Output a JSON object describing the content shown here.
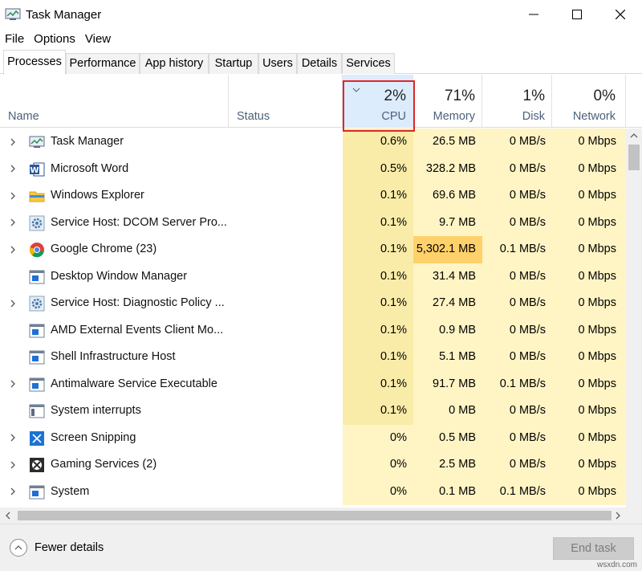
{
  "window": {
    "title": "Task Manager"
  },
  "menu": [
    "File",
    "Options",
    "View"
  ],
  "tabs": [
    "Processes",
    "Performance",
    "App history",
    "Startup",
    "Users",
    "Details",
    "Services"
  ],
  "header": {
    "name": "Name",
    "status": "Status",
    "cpu": {
      "pct": "2%",
      "label": "CPU"
    },
    "memory": {
      "pct": "71%",
      "label": "Memory"
    },
    "disk": {
      "pct": "1%",
      "label": "Disk"
    },
    "network": {
      "pct": "0%",
      "label": "Network"
    }
  },
  "rows": [
    {
      "name": "Task Manager",
      "icon": "task-manager-icon",
      "expand": true,
      "cpu": "0.6%",
      "memory": "26.5 MB",
      "disk": "0 MB/s",
      "network": "0 Mbps"
    },
    {
      "name": "Microsoft Word",
      "icon": "word-icon",
      "expand": true,
      "cpu": "0.5%",
      "memory": "328.2 MB",
      "disk": "0 MB/s",
      "network": "0 Mbps"
    },
    {
      "name": "Windows Explorer",
      "icon": "folder-icon",
      "expand": true,
      "cpu": "0.1%",
      "memory": "69.6 MB",
      "disk": "0 MB/s",
      "network": "0 Mbps"
    },
    {
      "name": "Service Host: DCOM Server Pro...",
      "icon": "gear-icon",
      "expand": true,
      "cpu": "0.1%",
      "memory": "9.7 MB",
      "disk": "0 MB/s",
      "network": "0 Mbps"
    },
    {
      "name": "Google Chrome (23)",
      "icon": "chrome-icon",
      "expand": true,
      "cpu": "0.1%",
      "memory": "5,302.1 MB",
      "disk": "0.1 MB/s",
      "network": "0 Mbps",
      "memHot": true
    },
    {
      "name": "Desktop Window Manager",
      "icon": "window-icon",
      "expand": false,
      "cpu": "0.1%",
      "memory": "31.4 MB",
      "disk": "0 MB/s",
      "network": "0 Mbps"
    },
    {
      "name": "Service Host: Diagnostic Policy ...",
      "icon": "gear-icon",
      "expand": true,
      "cpu": "0.1%",
      "memory": "27.4 MB",
      "disk": "0 MB/s",
      "network": "0 Mbps"
    },
    {
      "name": "AMD External Events Client Mo...",
      "icon": "window-icon",
      "expand": false,
      "cpu": "0.1%",
      "memory": "0.9 MB",
      "disk": "0 MB/s",
      "network": "0 Mbps"
    },
    {
      "name": "Shell Infrastructure Host",
      "icon": "window-icon",
      "expand": false,
      "cpu": "0.1%",
      "memory": "5.1 MB",
      "disk": "0 MB/s",
      "network": "0 Mbps"
    },
    {
      "name": "Antimalware Service Executable",
      "icon": "window-icon",
      "expand": true,
      "cpu": "0.1%",
      "memory": "91.7 MB",
      "disk": "0.1 MB/s",
      "network": "0 Mbps"
    },
    {
      "name": "System interrupts",
      "icon": "system-interrupts-icon",
      "expand": false,
      "cpu": "0.1%",
      "memory": "0 MB",
      "disk": "0 MB/s",
      "network": "0 Mbps"
    },
    {
      "name": "Screen Snipping",
      "icon": "snipping-icon",
      "expand": true,
      "cpu": "0%",
      "memory": "0.5 MB",
      "disk": "0 MB/s",
      "network": "0 Mbps"
    },
    {
      "name": "Gaming Services (2)",
      "icon": "xbox-icon",
      "expand": true,
      "cpu": "0%",
      "memory": "2.5 MB",
      "disk": "0 MB/s",
      "network": "0 Mbps"
    },
    {
      "name": "System",
      "icon": "window-icon",
      "expand": true,
      "cpu": "0%",
      "memory": "0.1 MB",
      "disk": "0.1 MB/s",
      "network": "0 Mbps"
    }
  ],
  "footer": {
    "fewer_details": "Fewer details",
    "end_task": "End task"
  },
  "watermark": "wsxdn.com"
}
